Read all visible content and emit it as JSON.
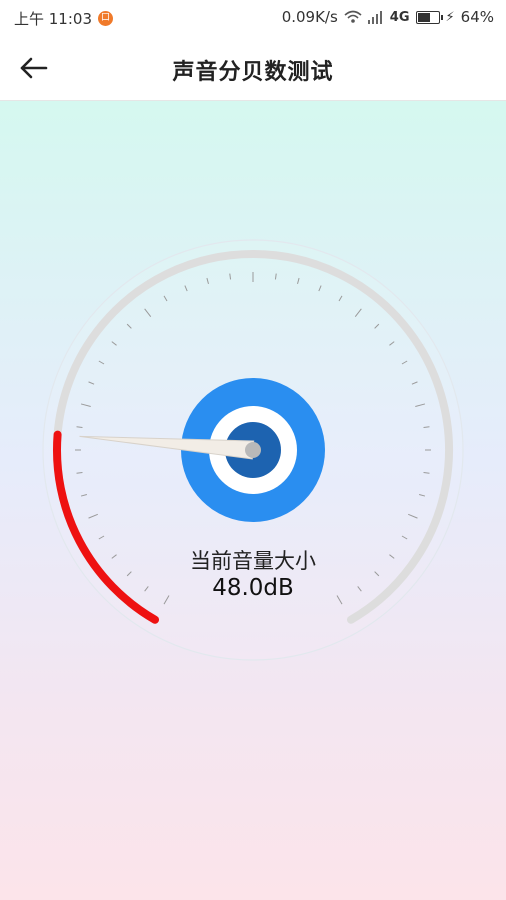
{
  "status_bar": {
    "time": "上午 11:03",
    "notification_badge": "口",
    "net_speed": "0.09K/s",
    "network_type": "4G",
    "battery": "64%",
    "battery_level": 0.64
  },
  "header": {
    "title": "声音分贝数测试",
    "back_icon": "arrow-left-icon"
  },
  "meter": {
    "caption": "当前音量大小",
    "value_text": "48.0dB",
    "level_fraction": 0.215,
    "active_color": "#ee1111",
    "track_color": "#dddddd",
    "hub_color": "#2a8ef0",
    "hub_dark": "#1d63b0"
  },
  "background": {
    "top_color": "#d5f8f0",
    "bottom_color": "#fce4ea"
  }
}
